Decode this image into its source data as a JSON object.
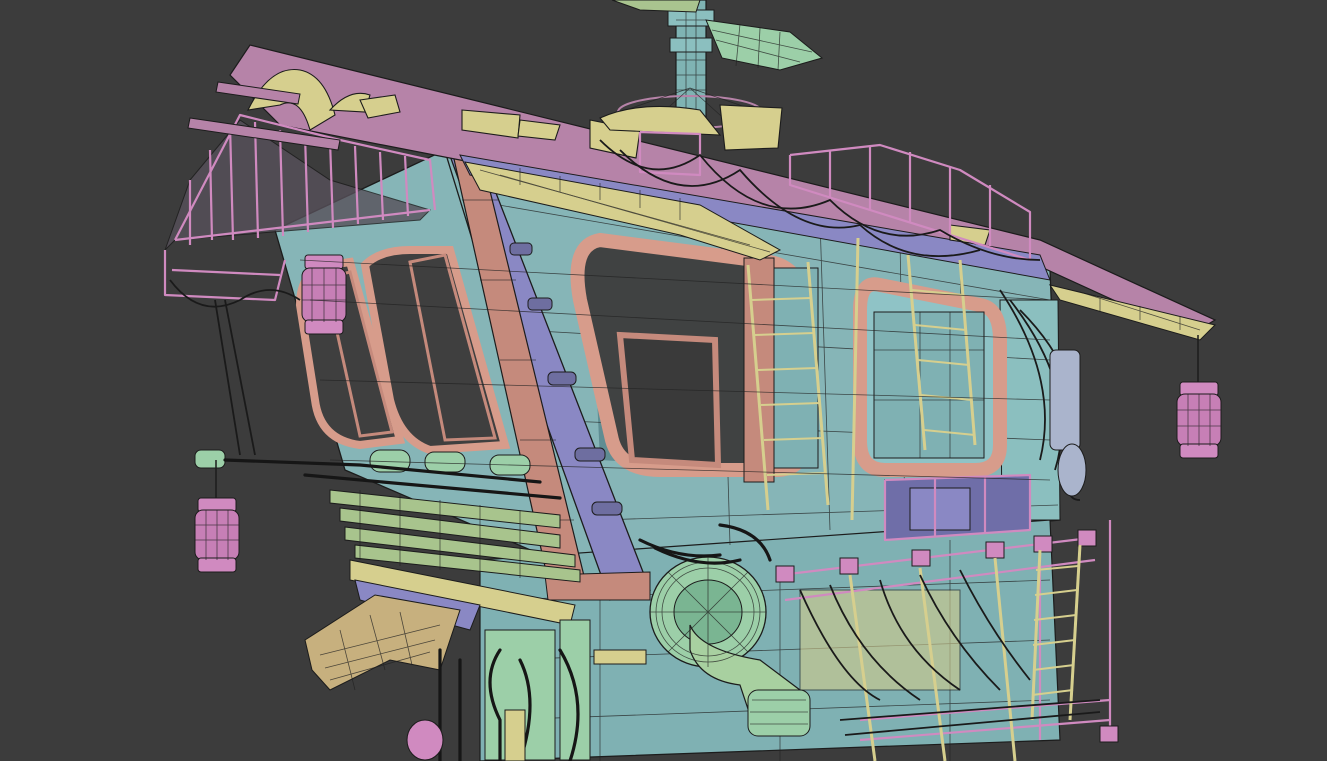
{
  "viewport": {
    "background": "#3c3c3c",
    "render_mode": "wireframe-over-solid"
  },
  "palette": {
    "body": "#86b5b7",
    "body_dark": "#6f9da1",
    "frame_pink": "#c58a7c",
    "frame_pink_light": "#d79c8b",
    "roof_pink": "#b683a8",
    "violet": "#8a88c4",
    "pale_yellow": "#d6cf8e",
    "sage_green": "#a8c48d",
    "mint": "#9ccfa8",
    "lantern_pink": "#d08ac0",
    "wire": "#1c1c1c"
  },
  "objects": [
    {
      "name": "cabin-body",
      "material": "teal"
    },
    {
      "name": "roof-railings",
      "material": "pink"
    },
    {
      "name": "window-frames",
      "material": "salmon"
    },
    {
      "name": "antenna-mast",
      "material": "teal"
    },
    {
      "name": "hanging-lanterns",
      "material": "pink"
    },
    {
      "name": "coiled-pipe",
      "material": "mint"
    },
    {
      "name": "ladders",
      "material": "cream"
    },
    {
      "name": "side-pipes-bundle",
      "material": "green"
    }
  ]
}
